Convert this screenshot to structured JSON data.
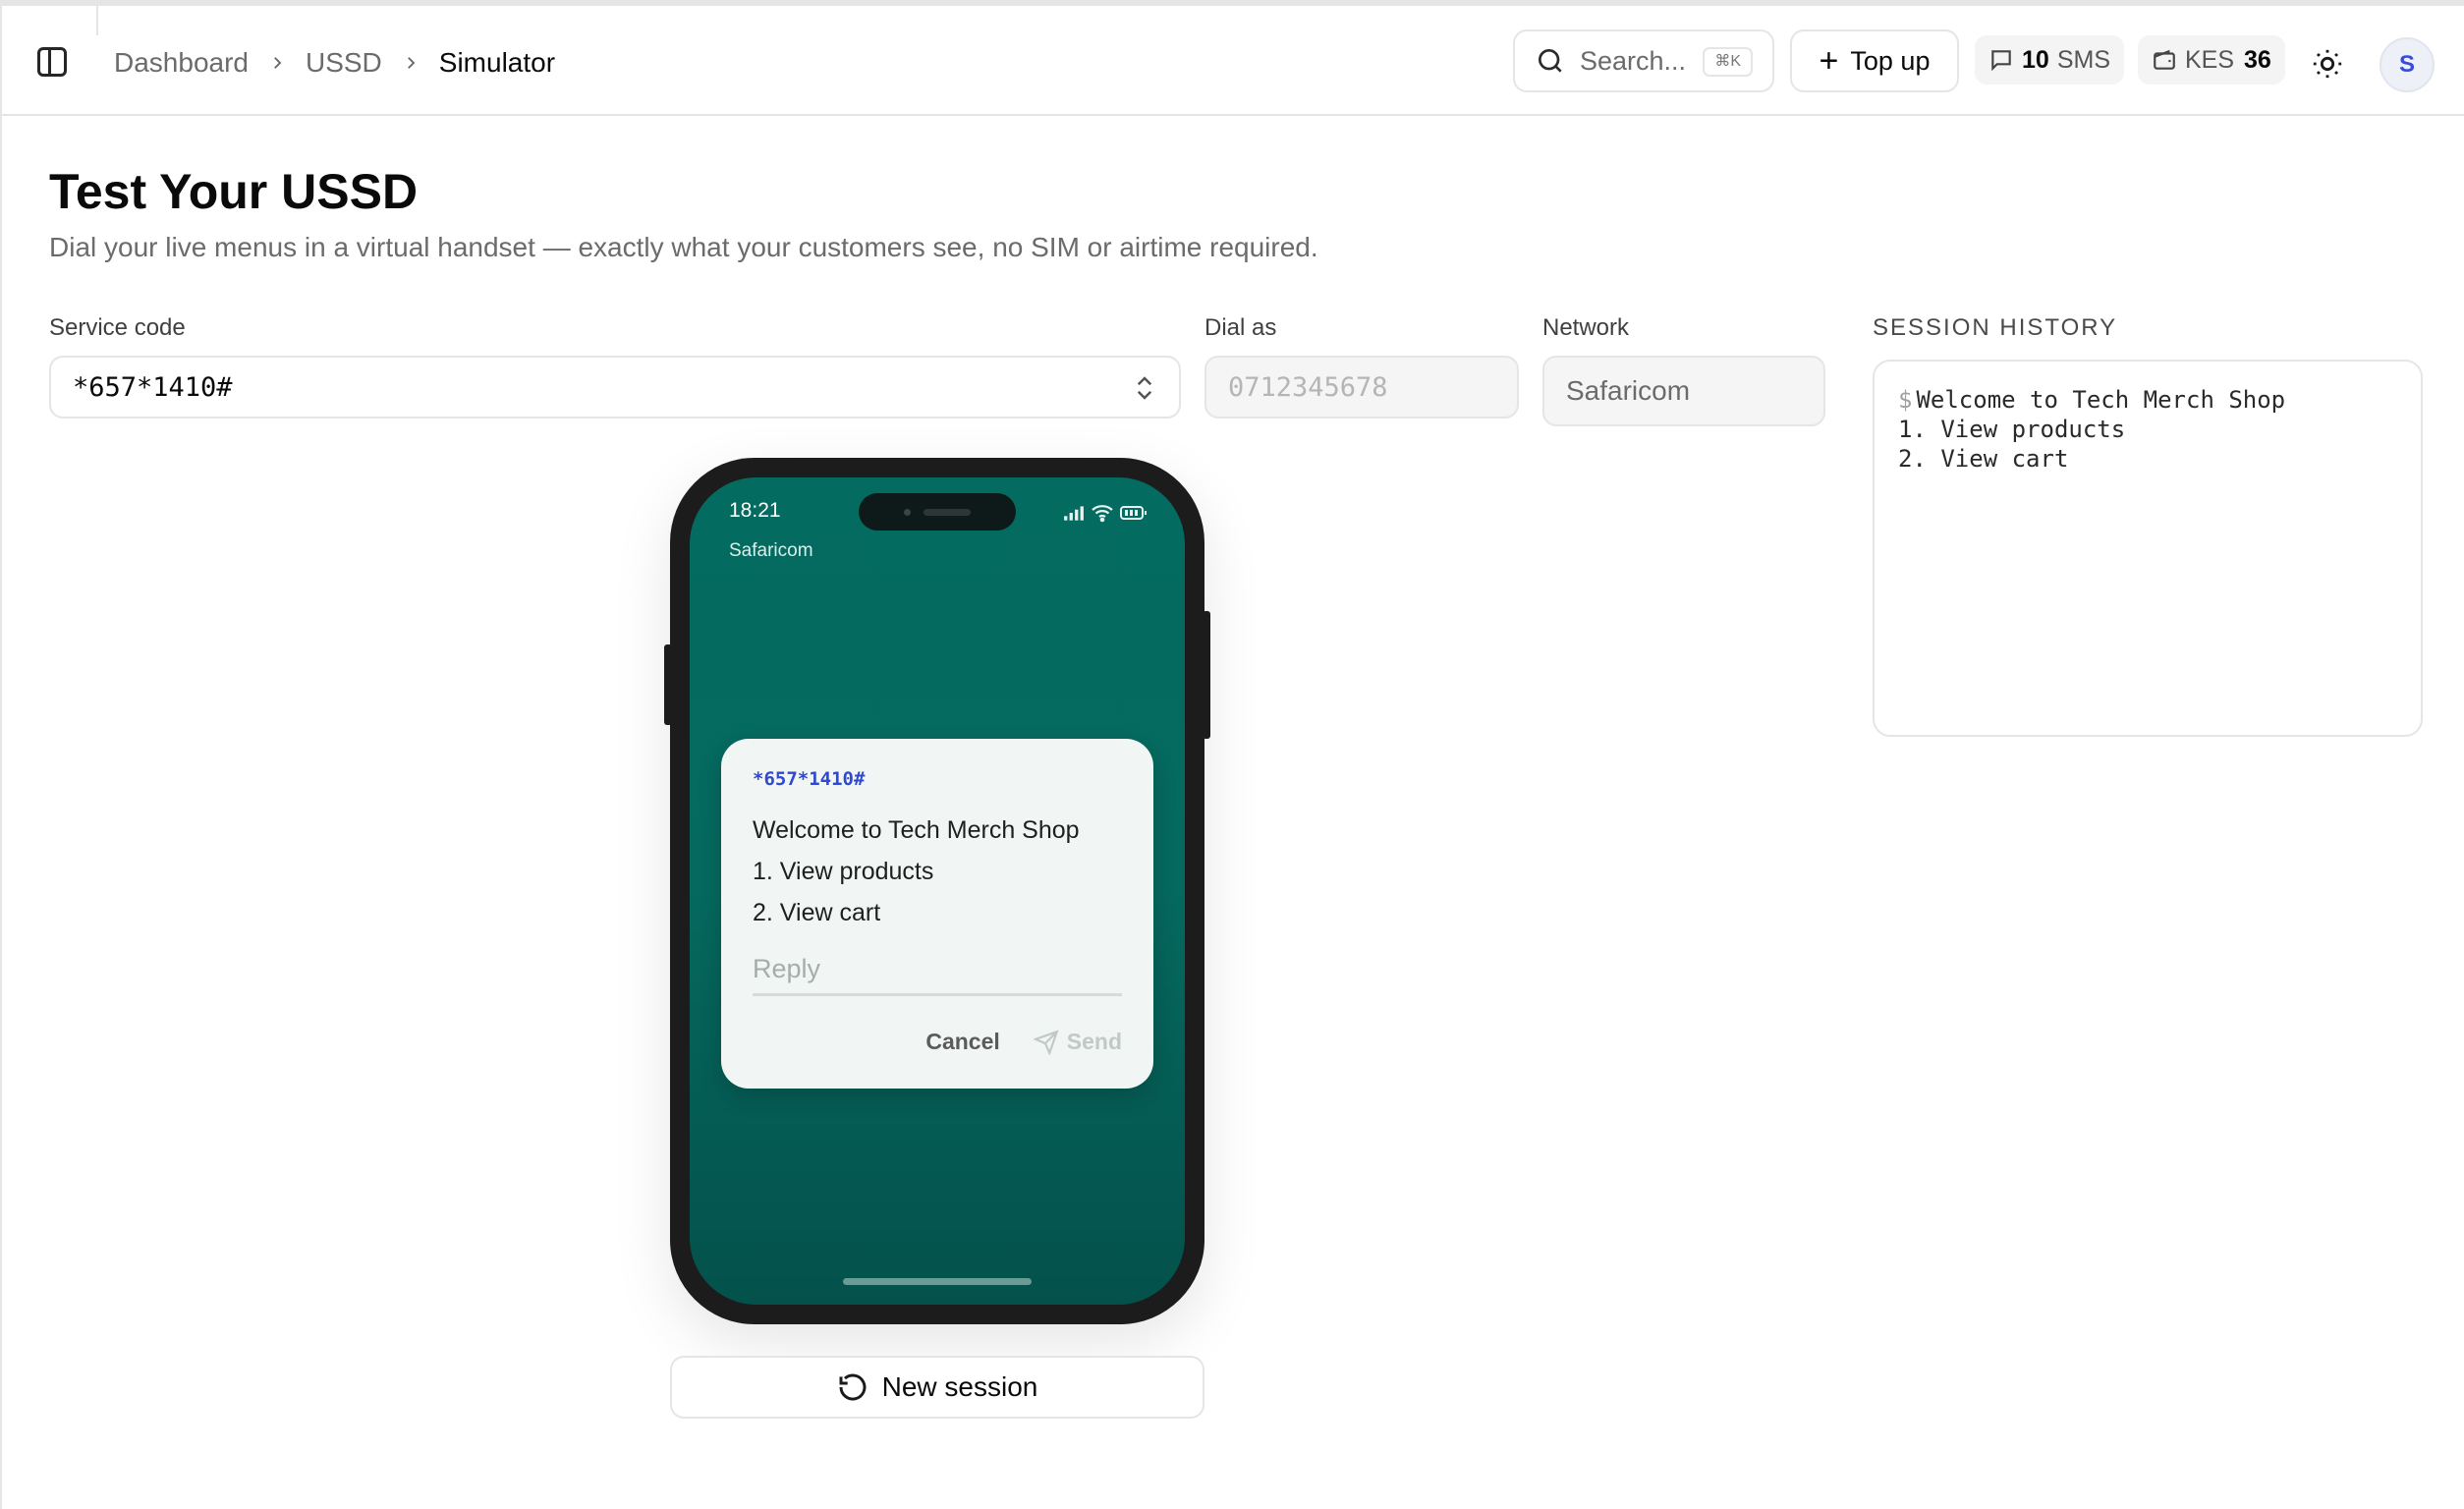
{
  "header": {
    "breadcrumb": [
      "Dashboard",
      "USSD",
      "Simulator"
    ],
    "search_placeholder": "Search...",
    "search_shortcut": "⌘K",
    "topup_label": "Top up",
    "sms_count": "10",
    "sms_unit": "SMS",
    "balance_currency": "KES",
    "balance_value": "36",
    "avatar_initial": "S"
  },
  "page": {
    "title": "Test Your USSD",
    "subtitle": "Dial your live menus in a virtual handset — exactly what your customers see, no SIM or airtime required."
  },
  "form": {
    "service_code_label": "Service code",
    "service_code_value": "*657*1410#",
    "dial_as_label": "Dial as",
    "dial_as_placeholder": "0712345678",
    "network_label": "Network",
    "network_value": "Safaricom"
  },
  "history": {
    "label": "SESSION HISTORY",
    "prompt": "$",
    "lines": [
      "Welcome to Tech Merch Shop",
      "1. View products",
      "2. View cart"
    ]
  },
  "phone": {
    "time": "18:21",
    "carrier": "Safaricom",
    "dialog": {
      "code": "*657*1410#",
      "lines": [
        "Welcome to Tech Merch Shop",
        "1. View products",
        "2. View cart"
      ],
      "reply_placeholder": "Reply",
      "cancel_label": "Cancel",
      "send_label": "Send"
    }
  },
  "new_session_label": "New session",
  "colors": {
    "accent": "#2f49d1",
    "phone_screen": "#046b61",
    "phone_body": "#1c1c1c"
  },
  "icons": [
    "sidebar-toggle-icon",
    "chevron-right-icon",
    "search-icon",
    "plus-icon",
    "message-icon",
    "wallet-icon",
    "sun-icon",
    "chevron-up-down-icon",
    "signal-icon",
    "wifi-icon",
    "battery-icon",
    "send-icon",
    "refresh-icon"
  ]
}
